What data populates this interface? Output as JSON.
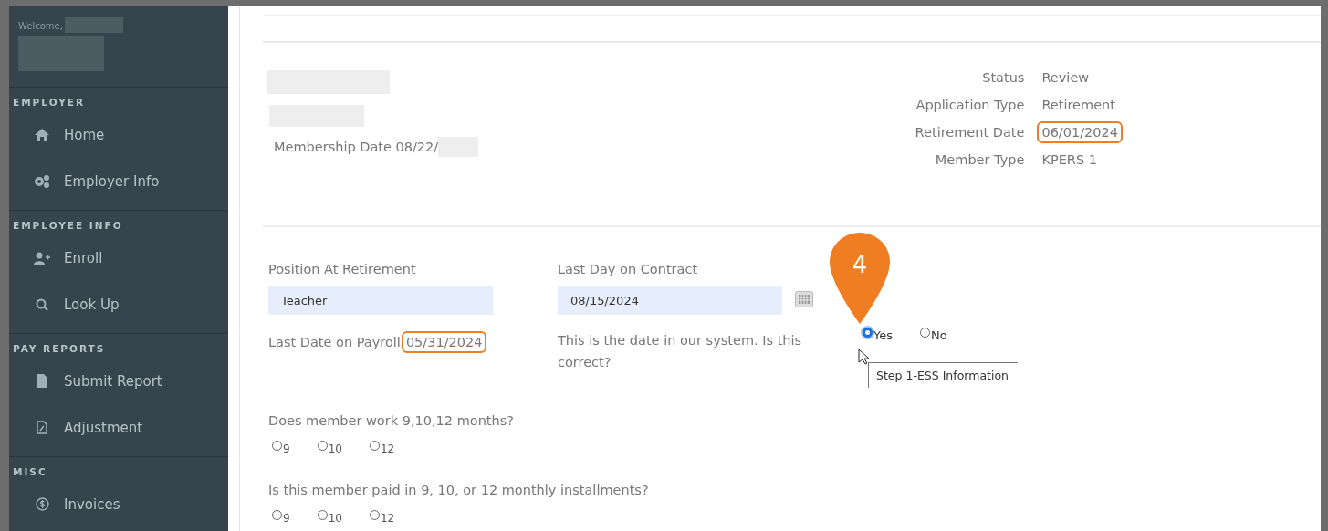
{
  "sidebar": {
    "welcome": "Welcome,",
    "sections": [
      {
        "heading": "EMPLOYER",
        "items": [
          {
            "label": "Home"
          },
          {
            "label": "Employer Info"
          }
        ]
      },
      {
        "heading": "EMPLOYEE INFO",
        "items": [
          {
            "label": "Enroll"
          },
          {
            "label": "Look Up"
          }
        ]
      },
      {
        "heading": "PAY REPORTS",
        "items": [
          {
            "label": "Submit Report"
          },
          {
            "label": "Adjustment"
          }
        ]
      },
      {
        "heading": "MISC",
        "items": [
          {
            "label": "Invoices"
          }
        ]
      }
    ]
  },
  "member": {
    "membership_date": "Membership Date 08/22/"
  },
  "details": [
    {
      "label": "Status",
      "value": "Review",
      "highlighted": false
    },
    {
      "label": "Application Type",
      "value": "Retirement",
      "highlighted": false
    },
    {
      "label": "Retirement Date",
      "value": "06/01/2024",
      "highlighted": true
    },
    {
      "label": "Member Type",
      "value": "KPERS 1",
      "highlighted": false
    }
  ],
  "form": {
    "position": {
      "label": "Position At Retirement",
      "value": "Teacher"
    },
    "last_day_contract": {
      "label": "Last Day on Contract",
      "value": "08/15/2024"
    },
    "last_date_payroll": {
      "label": "Last Date on Payroll",
      "value": "05/31/2024",
      "highlighted": true
    },
    "confirm": {
      "question": "This is the date in our system. Is this correct?",
      "options": [
        {
          "label": "Yes",
          "selected": true
        },
        {
          "label": "No",
          "selected": false
        }
      ]
    },
    "tooltip": "Step 1-ESS Information",
    "step_marker": "4",
    "questions": [
      {
        "question": "Does member work 9,10,12 months?",
        "options": [
          {
            "label": "9",
            "selected": false
          },
          {
            "label": "10",
            "selected": false
          },
          {
            "label": "12",
            "selected": false
          }
        ]
      },
      {
        "question": "Is this member paid in 9, 10, or 12 monthly installments?",
        "options": [
          {
            "label": "9",
            "selected": false
          },
          {
            "label": "10",
            "selected": false
          },
          {
            "label": "12",
            "selected": false
          }
        ]
      }
    ]
  }
}
